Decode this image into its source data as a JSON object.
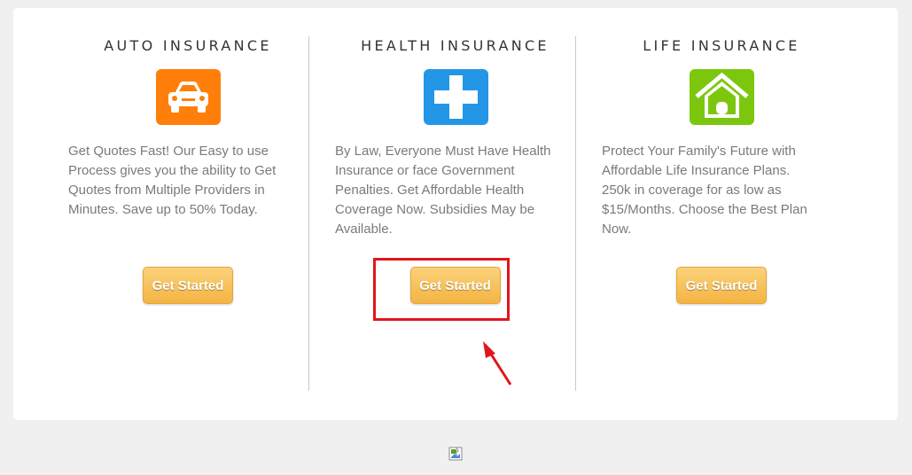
{
  "columns": [
    {
      "title": "AUTO INSURANCE",
      "icon": "car-icon",
      "color": "#ff7f0a",
      "description": "Get Quotes Fast! Our Easy to use Process gives you the ability to Get Quotes from Multiple Providers in Minutes. Save up to 50% Today.",
      "button_label": "Get Started"
    },
    {
      "title": "HEALTH INSURANCE",
      "icon": "plus-icon",
      "color": "#2496e6",
      "description": "By Law, Everyone Must Have Health Insurance or face Government Penalties. Get Affordable Health Coverage Now. Subsidies May be Available.",
      "button_label": "Get Started"
    },
    {
      "title": "LIFE INSURANCE",
      "icon": "house-icon",
      "color": "#7cc70e",
      "description": "Protect Your Family's Future with Affordable Life Insurance Plans. 250k in coverage for as low as $15/Months. Choose the Best Plan Now.",
      "button_label": "Get Started"
    }
  ],
  "annotation": {
    "highlight_color": "#e0161c",
    "target": "health-get-started-button"
  },
  "footer_image": "broken-image-icon"
}
